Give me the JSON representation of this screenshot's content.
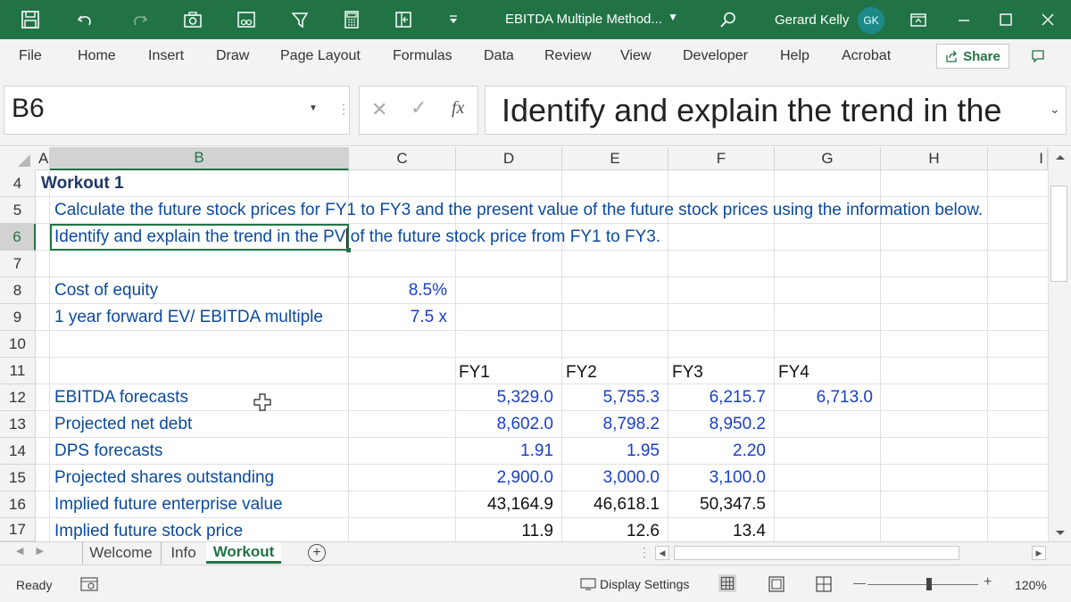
{
  "window": {
    "doc_title": "EBITDA Multiple Method...",
    "user_name": "Gerard Kelly",
    "user_initials": "GK"
  },
  "ribbon": {
    "tabs": [
      "File",
      "Home",
      "Insert",
      "Draw",
      "Page Layout",
      "Formulas",
      "Data",
      "Review",
      "View",
      "Developer",
      "Help",
      "Acrobat"
    ],
    "share_label": "Share"
  },
  "formula_bar": {
    "name_box": "B6",
    "fx_label": "fx",
    "content": "Identify and explain the trend in the"
  },
  "grid": {
    "columns": [
      "A",
      "B",
      "C",
      "D",
      "E",
      "F",
      "G",
      "H",
      "I"
    ],
    "rows": [
      "4",
      "5",
      "6",
      "7",
      "8",
      "9",
      "10",
      "11",
      "12",
      "13",
      "14",
      "15",
      "16",
      "17"
    ],
    "cells": {
      "a4": "Workout 1",
      "b5": "Calculate the future stock prices for FY1 to FY3 and the present value of the future stock prices using the information below.",
      "b6": "Identify and explain the trend in the PV of the future stock price from FY1 to FY3.",
      "b8": "Cost of equity",
      "c8": "8.5%",
      "b9": "1 year forward EV/ EBITDA multiple",
      "c9": "7.5 x",
      "d11": "FY1",
      "e11": "FY2",
      "f11": "FY3",
      "g11": "FY4",
      "b12": "EBITDA forecasts",
      "d12": "5,329.0",
      "e12": "5,755.3",
      "f12": "6,215.7",
      "g12": "6,713.0",
      "b13": "Projected net debt",
      "d13": "8,602.0",
      "e13": "8,798.2",
      "f13": "8,950.2",
      "b14": "DPS forecasts",
      "d14": "1.91",
      "e14": "1.95",
      "f14": "2.20",
      "b15": "Projected shares outstanding",
      "d15": "2,900.0",
      "e15": "3,000.0",
      "f15": "3,100.0",
      "b16": "Implied future enterprise value",
      "d16": "43,164.9",
      "e16": "46,618.1",
      "f16": "50,347.5",
      "b17": "Implied future stock price",
      "d17": "11.9",
      "e17": "12.6",
      "f17": "13.4"
    }
  },
  "sheets": {
    "tabs": [
      "Welcome",
      "Info",
      "Workout"
    ],
    "active": "Workout"
  },
  "status": {
    "ready": "Ready",
    "display_settings": "Display Settings",
    "zoom": "120%"
  },
  "colors": {
    "accent": "#217346",
    "label_blue": "#0b4a9e",
    "input_blue": "#1a3fc7"
  }
}
